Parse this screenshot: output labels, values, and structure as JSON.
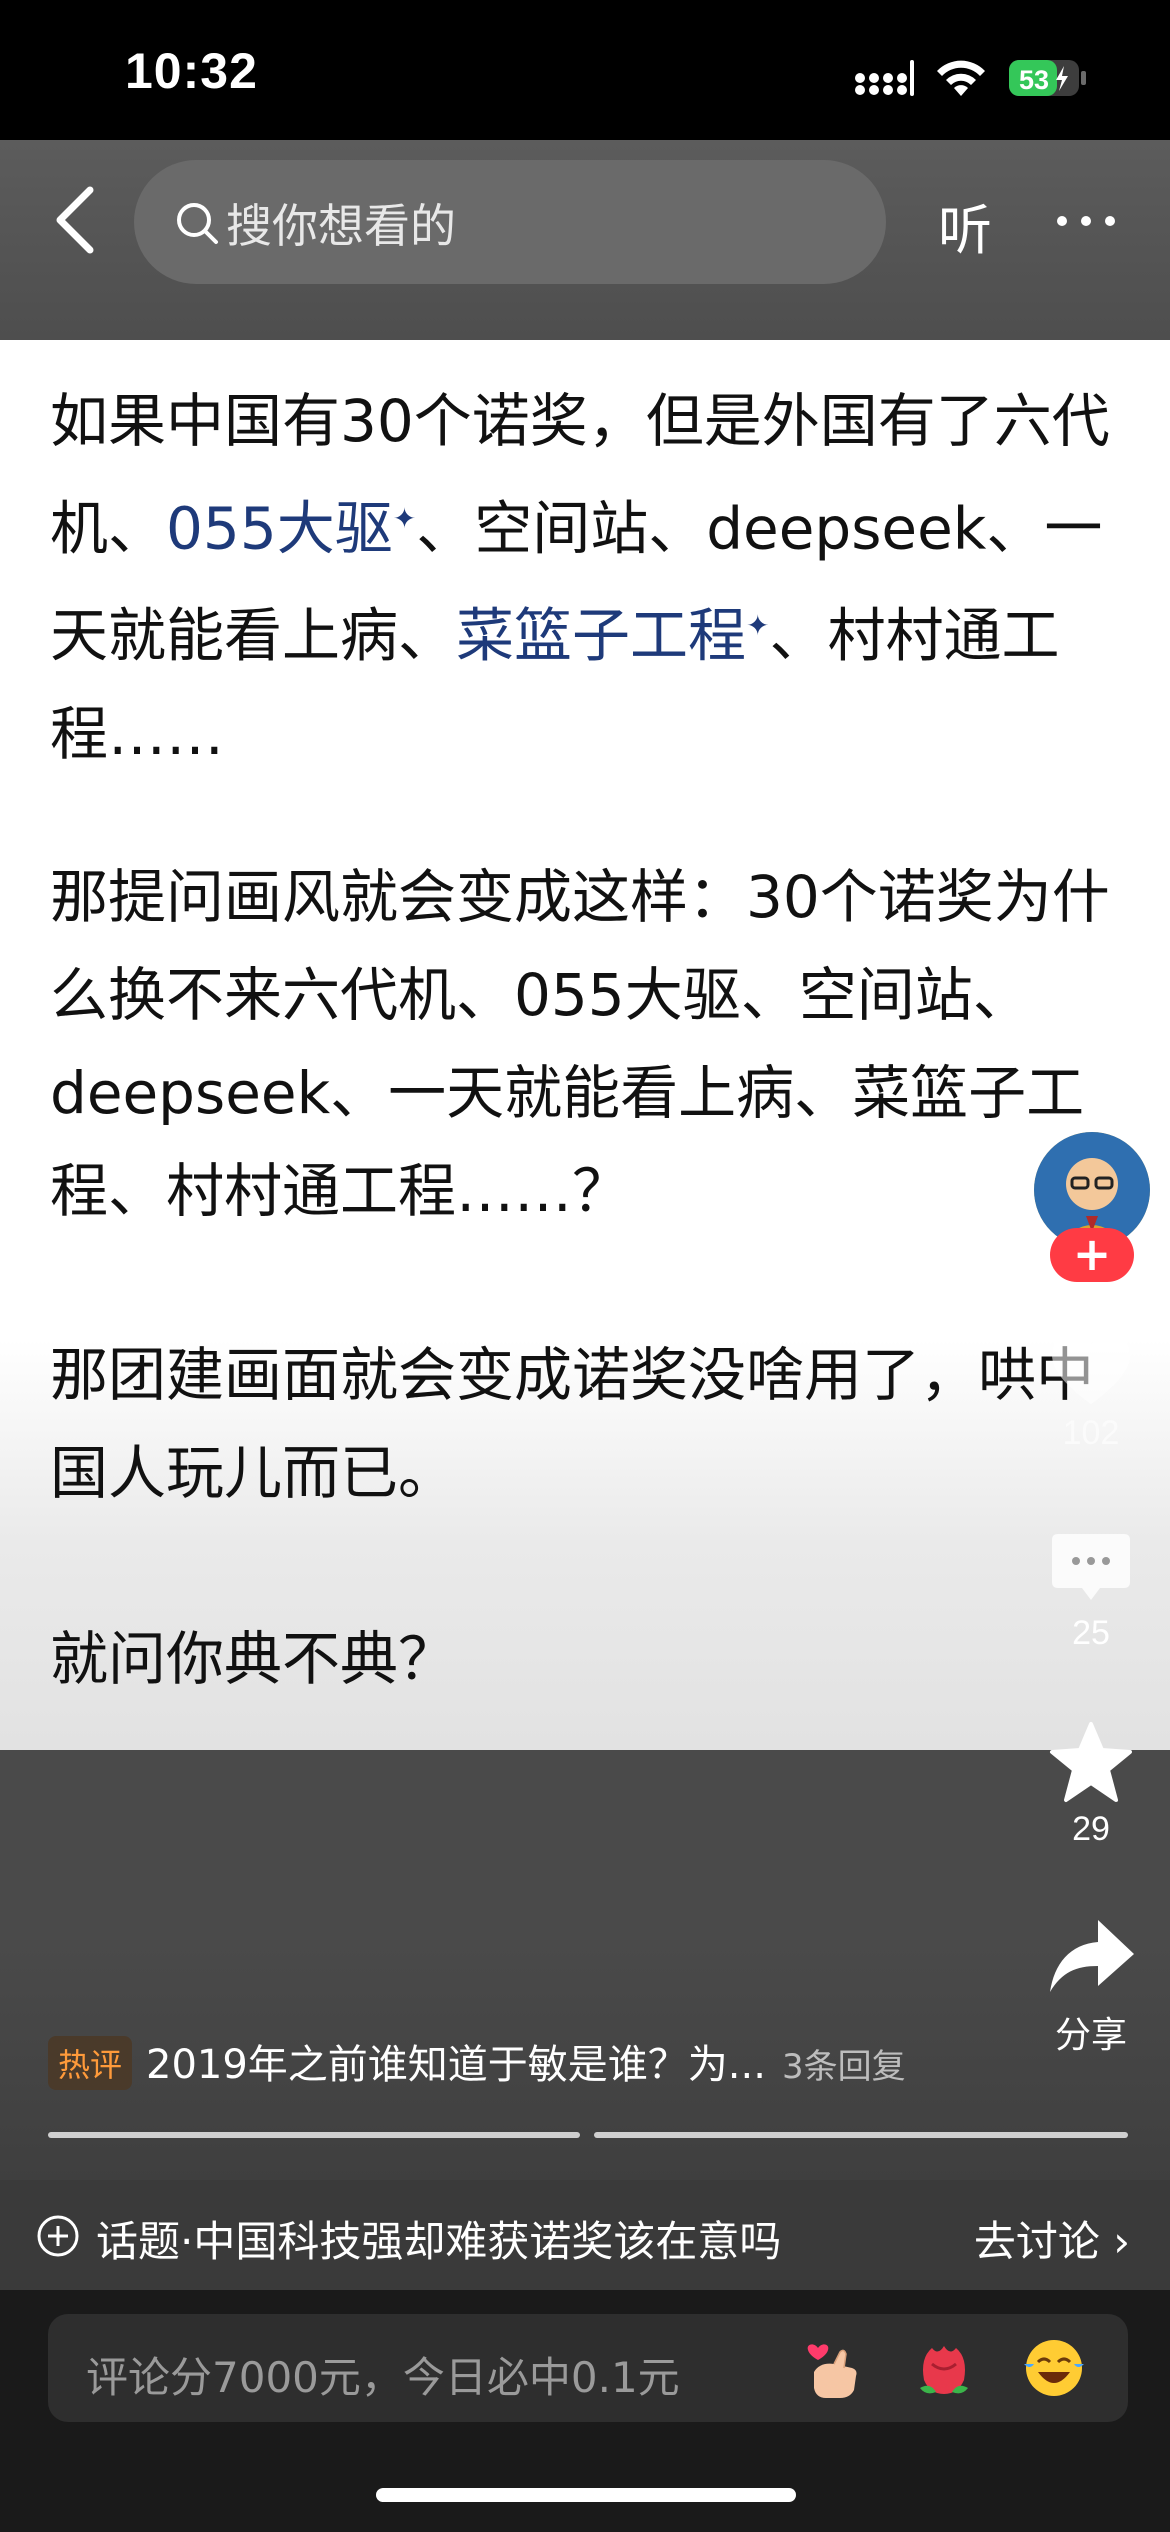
{
  "status_bar": {
    "time": "10:32",
    "battery": "53"
  },
  "nav": {
    "search_placeholder": "搜你想看的",
    "listen_label": "听"
  },
  "article": {
    "p1": {
      "a": "如果中国有30个诺奖，但是外国有了六代机、",
      "link1": "055大驱",
      "b": "、空间站、deepseek、一天就能看上病、",
      "link2": "菜篮子工程",
      "c": "、村村通工程……"
    },
    "p2": "那提问画风就会变成这样：30个诺奖为什么换不来六代机、055大驱、空间站、deepseek、一天就能看上病、菜篮子工程、村村通工程……？",
    "p3": "那团建画面就会变成诺奖没啥用了，哄中国人玩儿而已。",
    "p4": "就问你典不典？"
  },
  "actions": {
    "like_count": "102",
    "comment_count": "25",
    "favorite_count": "29",
    "share_label": "分享"
  },
  "hot_comment": {
    "badge": "热评",
    "text": "2019年之前谁知道于敏是谁？为...",
    "replies": "3条回复"
  },
  "topic": {
    "text": "话题·中国科技强却难获诺奖该在意吗",
    "action": "去讨论 ›"
  },
  "comment_input": {
    "placeholder": "评论分7000元，今日必中0.1元"
  },
  "colors": {
    "follow": "#ff3b44",
    "battery": "#34c759",
    "link": "#1e3a7a"
  }
}
